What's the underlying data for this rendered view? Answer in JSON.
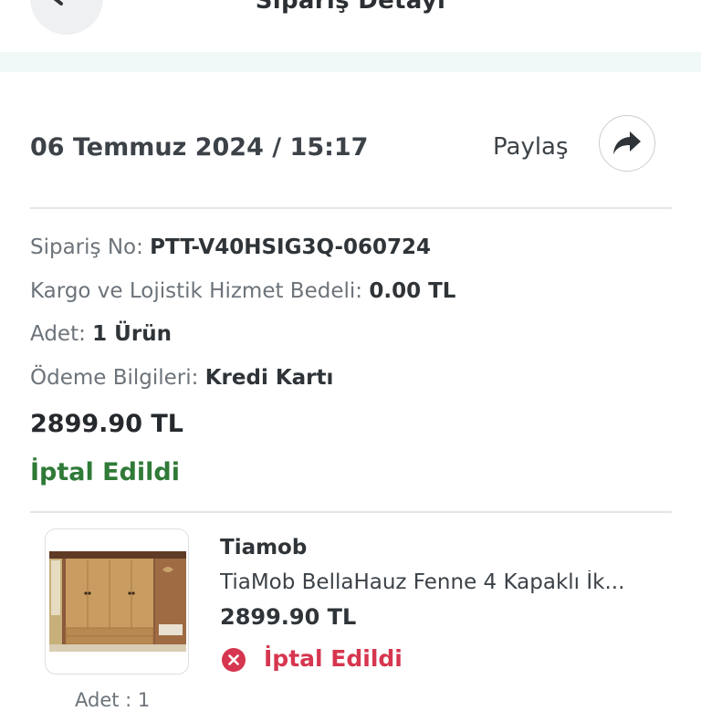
{
  "header": {
    "title": "Sipariş Detayı",
    "back_icon": "arrow-left-icon"
  },
  "order": {
    "date": "06 Temmuz 2024 / 15:17",
    "share_label": "Paylaş",
    "share_icon": "share-arrow-icon",
    "order_no_label": "Sipariş No:",
    "order_no_value": "PTT-V40HSIG3Q-060724",
    "cargo_label": "Kargo ve Lojistik Hizmet Bedeli:",
    "cargo_value": "0.00 TL",
    "qty_label": "Adet:",
    "qty_value": "1 Ürün",
    "payment_label": "Ödeme Bilgileri:",
    "payment_value": "Kredi Kartı",
    "total": "2899.90 TL",
    "status": "İptal Edildi",
    "status_color": "#2f7a37"
  },
  "item": {
    "brand": "Tiamob",
    "name": "TiaMob  BellaHauz Fenne 4 Kapaklı İk...",
    "price": "2899.90 TL",
    "status": "İptal Edildi",
    "status_color": "#d6364f",
    "status_icon": "cancel-circle-icon",
    "quantity": "Adet : 1"
  }
}
